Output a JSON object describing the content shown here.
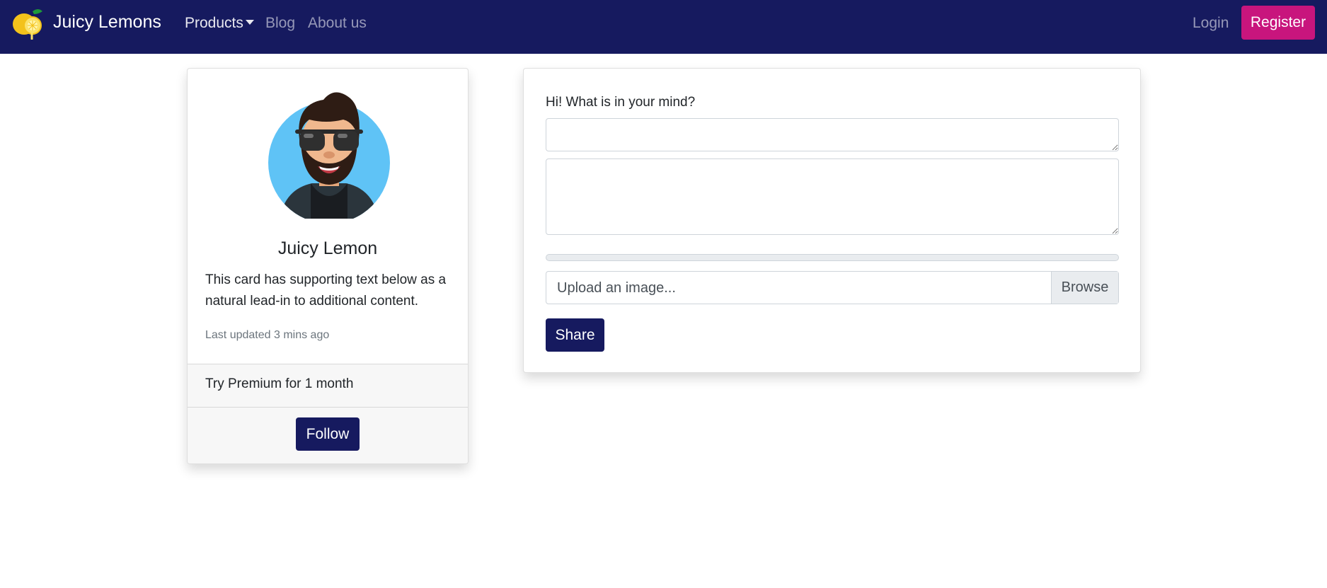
{
  "navbar": {
    "brand": "Juicy Lemons",
    "logo_icon": "lemon-icon",
    "links": [
      {
        "label": "Products",
        "dropdown": true
      },
      {
        "label": "Blog"
      },
      {
        "label": "About us"
      }
    ],
    "login_label": "Login",
    "register_label": "Register",
    "colors": {
      "navbar_bg": "#161a5f",
      "register_bg": "#c8157d"
    }
  },
  "profile_card": {
    "avatar_icon": "avatar-icon",
    "name": "Juicy Lemon",
    "text": "This card has supporting text below as a natural lead-in to additional content.",
    "updated": "Last updated 3 mins ago",
    "premium": "Try Premium for 1 month",
    "follow_label": "Follow"
  },
  "post_form": {
    "prompt": "Hi! What is in your mind?",
    "title_value": "",
    "body_value": "",
    "upload_progress": 0,
    "upload_placeholder": "Upload an image...",
    "browse_label": "Browse",
    "share_label": "Share"
  }
}
